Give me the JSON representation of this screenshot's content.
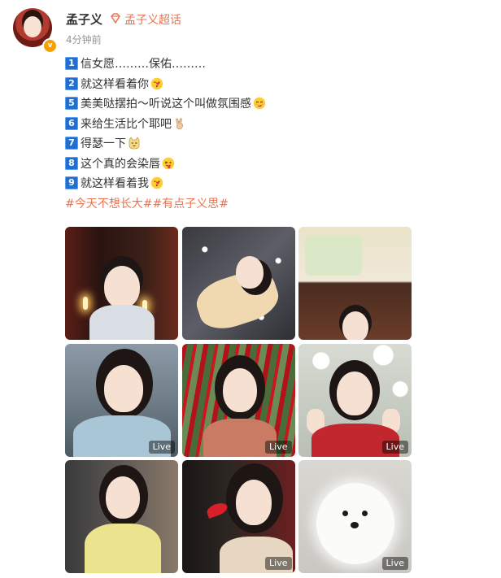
{
  "post": {
    "author": "孟子义",
    "supertopic": "孟子义超话",
    "time": "4分钟前",
    "lines": [
      {
        "num": "1",
        "text": "信女愿………保佑………",
        "emoji": ""
      },
      {
        "num": "2",
        "text": "就这样看着你",
        "emoji": "heart-kiss-emoji"
      },
      {
        "num": "5",
        "text": "美美哒摆拍～听说这个叫做氛围感",
        "emoji": "smirk-emoji"
      },
      {
        "num": "6",
        "text": "来给生活比个耶吧",
        "emoji": "victory-hand-emoji"
      },
      {
        "num": "7",
        "text": "得瑟一下",
        "emoji": "smug-cat-emoji"
      },
      {
        "num": "8",
        "text": "这个真的会染唇",
        "emoji": "tongue-out-emoji"
      },
      {
        "num": "9",
        "text": "就这样看着我",
        "emoji": "heart-kiss-emoji"
      }
    ],
    "hashtags": "#今天不想长大##有点子义思#"
  },
  "photos": [
    {
      "live": ""
    },
    {
      "live": ""
    },
    {
      "live": ""
    },
    {
      "live": "Live"
    },
    {
      "live": "Live"
    },
    {
      "live": "Live"
    },
    {
      "live": ""
    },
    {
      "live": "Live"
    },
    {
      "live": "Live"
    }
  ],
  "colors": {
    "link": "#eb7350",
    "badge": "#1f6fd1",
    "verified": "#f7a100"
  }
}
